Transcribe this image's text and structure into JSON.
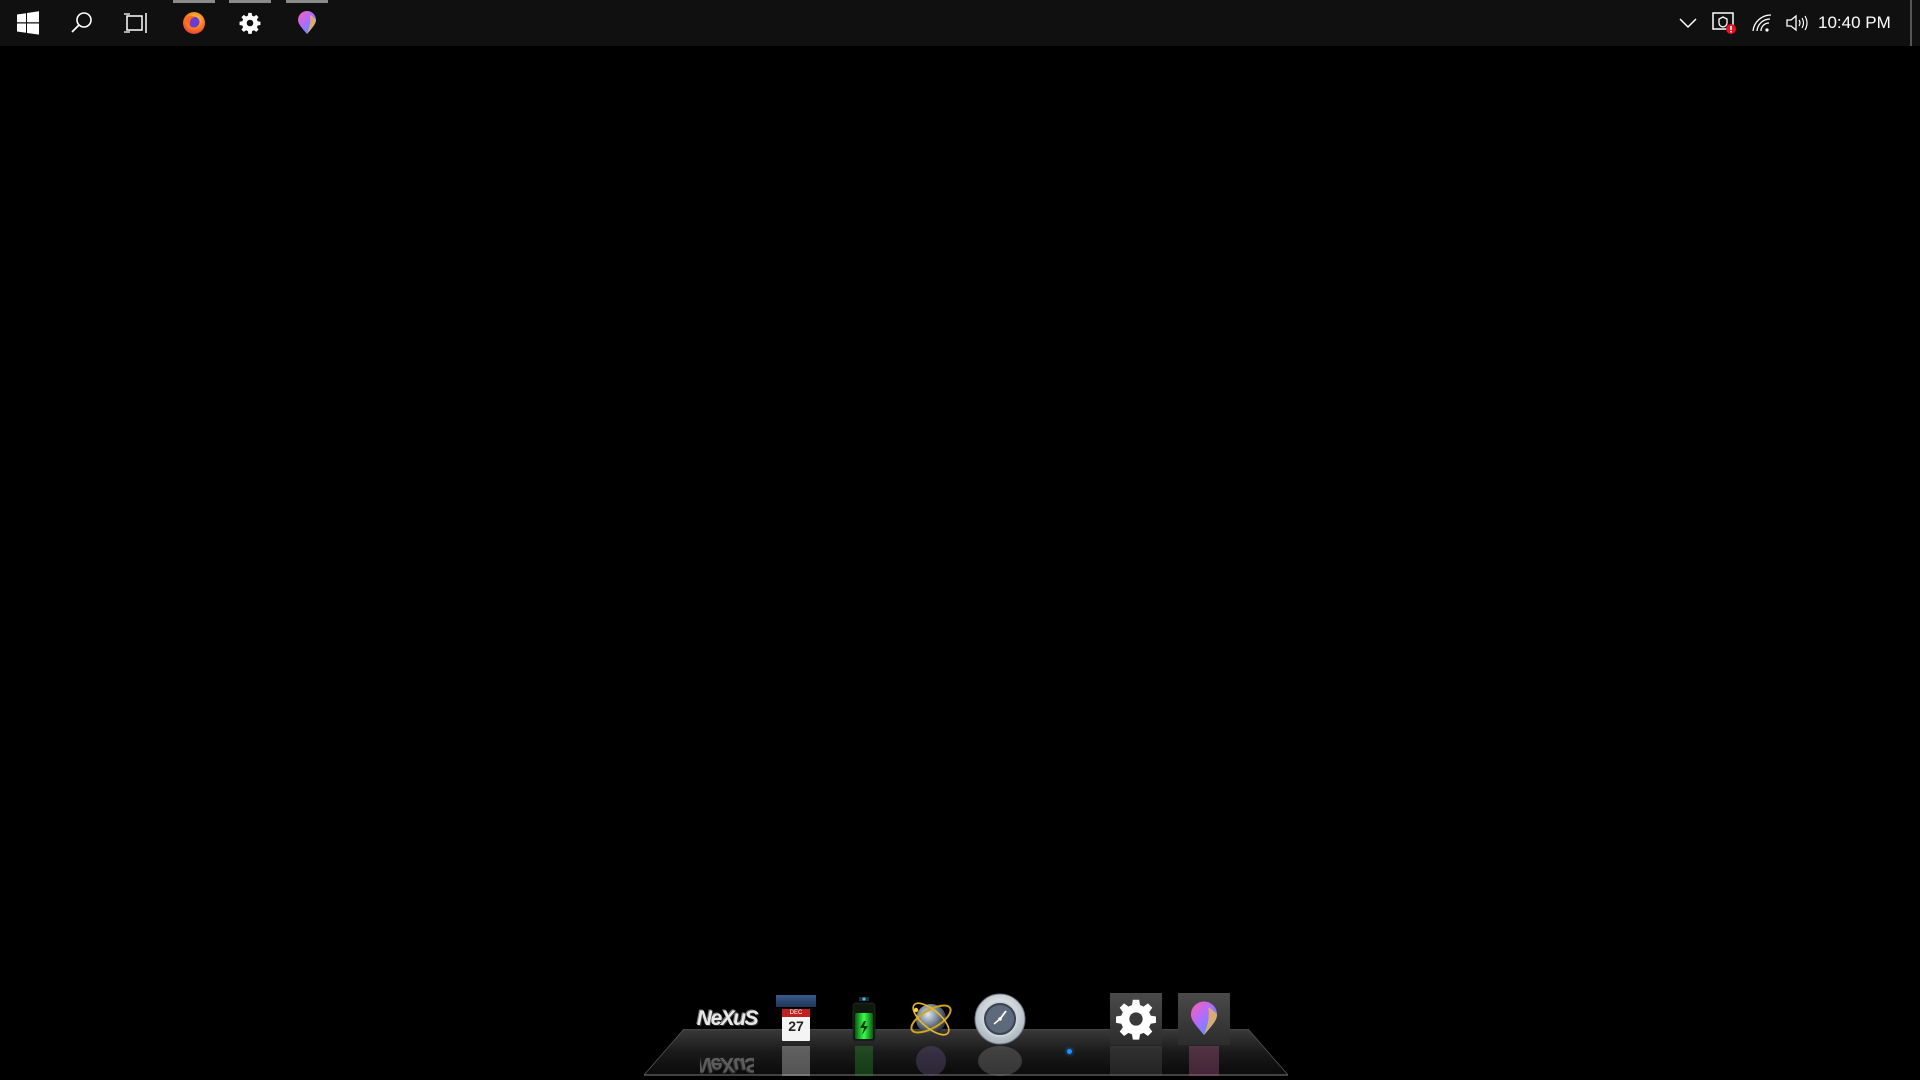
{
  "taskbar": {
    "start_label": "Start",
    "search_label": "Search",
    "task_view_label": "Task View",
    "pinned": [
      {
        "name": "Firefox",
        "icon": "firefox-icon",
        "running": true
      },
      {
        "name": "Settings",
        "icon": "gear-icon",
        "running": true
      },
      {
        "name": "Paint 3D",
        "icon": "paint3d-icon",
        "running": true
      }
    ],
    "tray": {
      "overflow_icon": "chevron-up-icon",
      "security_icon": "security-alert-icon",
      "network_icon": "wifi-icon",
      "volume_icon": "volume-icon"
    },
    "clock": "10:40 PM"
  },
  "dock": {
    "items": [
      {
        "name": "Nexus",
        "label": "NeXuS"
      },
      {
        "name": "Calendar",
        "month": "DEC",
        "day": "27"
      },
      {
        "name": "Battery"
      },
      {
        "name": "Internet"
      },
      {
        "name": "Clock"
      },
      {
        "name": "Settings"
      },
      {
        "name": "Paint 3D"
      }
    ]
  },
  "colors": {
    "taskbar_bg": "#101010",
    "desktop_bg": "#000000",
    "running_indicator": "#8a8a8a",
    "dock_active_dot": "#1e90ff"
  }
}
